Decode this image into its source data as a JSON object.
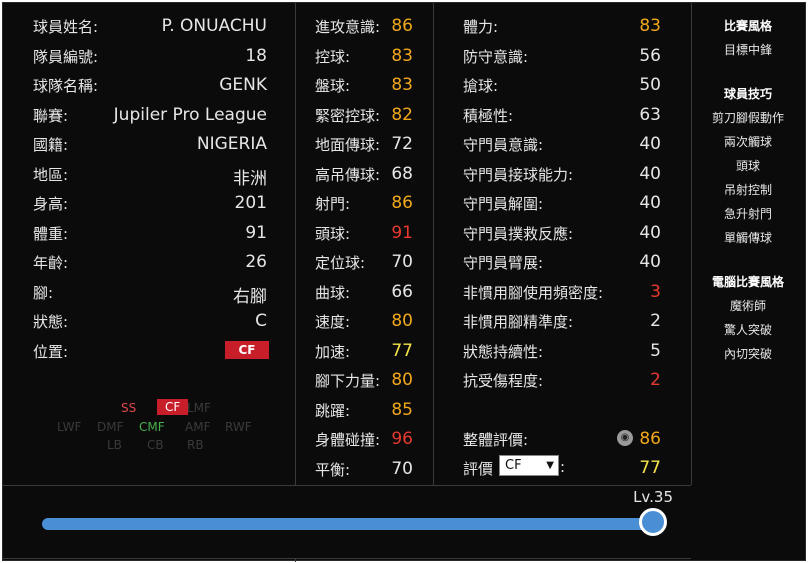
{
  "player": {
    "rows": [
      {
        "label": "球員姓名:",
        "value": "P. ONUACHU"
      },
      {
        "label": "隊員編號:",
        "value": "18"
      },
      {
        "label": "球隊名稱:",
        "value": "GENK"
      },
      {
        "label": "聯賽:",
        "value": "Jupiler Pro League"
      },
      {
        "label": "國籍:",
        "value": "NIGERIA"
      },
      {
        "label": "地區:",
        "value": "非洲"
      },
      {
        "label": "身高:",
        "value": "201"
      },
      {
        "label": "體重:",
        "value": "91"
      },
      {
        "label": "年齡:",
        "value": "26"
      },
      {
        "label": "腳:",
        "value": "右腳"
      },
      {
        "label": "狀態:",
        "value": "C"
      }
    ],
    "position_label": "位置:",
    "position_value": "CF"
  },
  "position_map": {
    "ss": "SS",
    "cf": "CF",
    "cmf": "CMF",
    "dim": [
      "LWF",
      "DMF",
      "RWF",
      "AMF",
      "LB",
      "CB",
      "RB",
      "LMF"
    ]
  },
  "stats_mid": [
    {
      "label": "進攻意識:",
      "value": "86",
      "color": "#f2a81c"
    },
    {
      "label": "控球:",
      "value": "83",
      "color": "#f2a81c"
    },
    {
      "label": "盤球:",
      "value": "83",
      "color": "#f2a81c"
    },
    {
      "label": "緊密控球:",
      "value": "82",
      "color": "#f2a81c"
    },
    {
      "label": "地面傳球:",
      "value": "72",
      "color": "#e6e6e6"
    },
    {
      "label": "高吊傳球:",
      "value": "68",
      "color": "#e6e6e6"
    },
    {
      "label": "射門:",
      "value": "86",
      "color": "#f2a81c"
    },
    {
      "label": "頭球:",
      "value": "91",
      "color": "#e63a2e"
    },
    {
      "label": "定位球:",
      "value": "70",
      "color": "#e6e6e6"
    },
    {
      "label": "曲球:",
      "value": "66",
      "color": "#e6e6e6"
    },
    {
      "label": "速度:",
      "value": "80",
      "color": "#f2a81c"
    },
    {
      "label": "加速:",
      "value": "77",
      "color": "#f4e44a"
    },
    {
      "label": "腳下力量:",
      "value": "80",
      "color": "#f2a81c"
    },
    {
      "label": "跳躍:",
      "value": "85",
      "color": "#f2a81c"
    },
    {
      "label": "身體碰撞:",
      "value": "96",
      "color": "#e63a2e"
    },
    {
      "label": "平衡:",
      "value": "70",
      "color": "#e6e6e6"
    }
  ],
  "stats_right": [
    {
      "label": "體力:",
      "value": "83",
      "color": "#f2a81c"
    },
    {
      "label": "防守意識:",
      "value": "56",
      "color": "#e6e6e6"
    },
    {
      "label": "搶球:",
      "value": "50",
      "color": "#e6e6e6"
    },
    {
      "label": "積極性:",
      "value": "63",
      "color": "#e6e6e6"
    },
    {
      "label": "守門員意識:",
      "value": "40",
      "color": "#e6e6e6"
    },
    {
      "label": "守門員接球能力:",
      "value": "40",
      "color": "#e6e6e6"
    },
    {
      "label": "守門員解圍:",
      "value": "40",
      "color": "#e6e6e6"
    },
    {
      "label": "守門員撲救反應:",
      "value": "40",
      "color": "#e6e6e6"
    },
    {
      "label": "守門員臂展:",
      "value": "40",
      "color": "#e6e6e6"
    },
    {
      "label": "非慣用腳使用頻密度:",
      "value": "3",
      "color": "#e63a2e"
    },
    {
      "label": "非慣用腳精準度:",
      "value": "2",
      "color": "#e6e6e6"
    },
    {
      "label": "狀態持續性:",
      "value": "5",
      "color": "#e6e6e6"
    },
    {
      "label": "抗受傷程度:",
      "value": "2",
      "color": "#e63a2e"
    }
  ],
  "overall": {
    "label": "整體評價:",
    "value": "86",
    "color": "#f2a81c"
  },
  "rating": {
    "label": "評價",
    "select": "CF",
    "colon": ":",
    "value": "77",
    "color": "#f4e44a"
  },
  "sidebar": {
    "style_title": "比賽風格",
    "style_value": "目標中鋒",
    "skills_title": "球員技巧",
    "skills": [
      "剪刀腳假動作",
      "兩次觸球",
      "頭球",
      "吊射控制",
      "急升射門",
      "單觸傳球"
    ],
    "ai_title": "電腦比賽風格",
    "ai_styles": [
      "魔術師",
      "驚人突破",
      "內切突破"
    ]
  },
  "level": {
    "label": "Lv.35",
    "progress": 1.0
  }
}
